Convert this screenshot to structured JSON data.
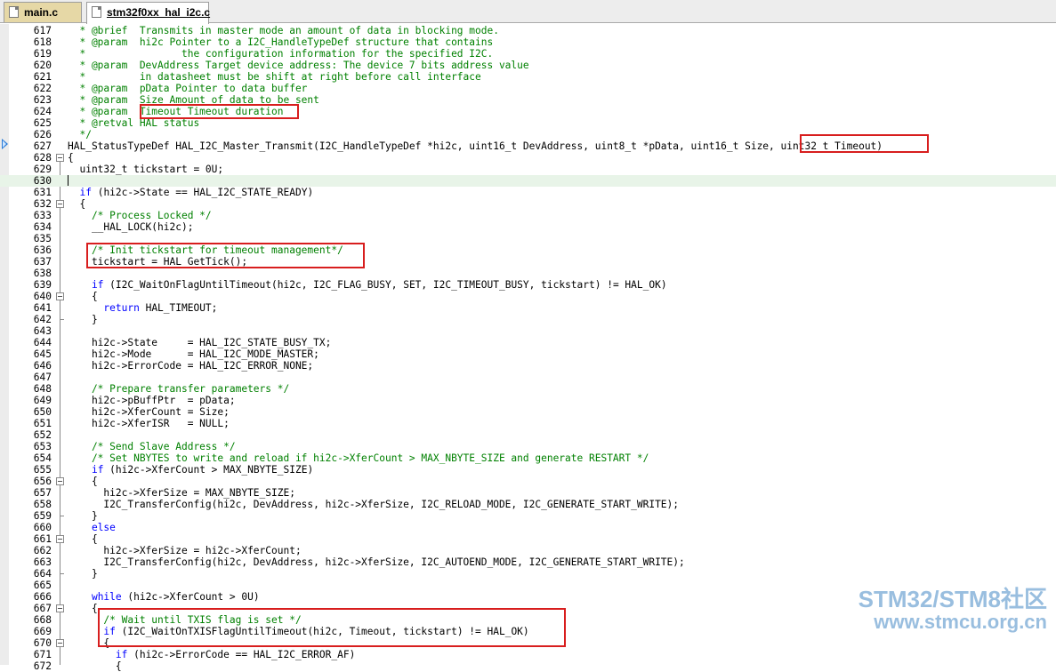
{
  "tabs": [
    {
      "label": "main.c",
      "active": false
    },
    {
      "label": "stm32f0xx_hal_i2c.c",
      "active": true
    }
  ],
  "editor": {
    "current_line": "630",
    "execution_line": "627",
    "lines": [
      {
        "num": "617",
        "fold": "",
        "segs": [
          {
            "t": "  * @brief  Transmits in master mode an amount of data in blocking mode.",
            "c": "c"
          }
        ]
      },
      {
        "num": "618",
        "fold": "",
        "segs": [
          {
            "t": "  * @param  hi2c Pointer to a I2C_HandleTypeDef structure that contains",
            "c": "c"
          }
        ]
      },
      {
        "num": "619",
        "fold": "",
        "segs": [
          {
            "t": "  *                the configuration information for the specified I2C.",
            "c": "c"
          }
        ]
      },
      {
        "num": "620",
        "fold": "",
        "segs": [
          {
            "t": "  * @param  DevAddress Target device address: The device 7 bits address value",
            "c": "c"
          }
        ]
      },
      {
        "num": "621",
        "fold": "",
        "segs": [
          {
            "t": "  *         in datasheet must be shift at right before call interface",
            "c": "c"
          }
        ]
      },
      {
        "num": "622",
        "fold": "",
        "segs": [
          {
            "t": "  * @param  pData Pointer to data buffer",
            "c": "c"
          }
        ]
      },
      {
        "num": "623",
        "fold": "",
        "segs": [
          {
            "t": "  * @param  Size Amount of data to be sent",
            "c": "c"
          }
        ]
      },
      {
        "num": "624",
        "fold": "",
        "segs": [
          {
            "t": "  * @param  Timeout Timeout duration",
            "c": "c"
          }
        ]
      },
      {
        "num": "625",
        "fold": "",
        "segs": [
          {
            "t": "  * @retval HAL status",
            "c": "c"
          }
        ]
      },
      {
        "num": "626",
        "fold": "",
        "segs": [
          {
            "t": "  */",
            "c": "c"
          }
        ]
      },
      {
        "num": "627",
        "fold": "",
        "segs": [
          {
            "t": "HAL_StatusTypeDef HAL_I2C_Master_Transmit(I2C_HandleTypeDef *hi2c, uint16_t DevAddress, uint8_t *pData, uint16_t Size, uint32_t Timeout)",
            "c": "n"
          }
        ]
      },
      {
        "num": "628",
        "fold": "open",
        "segs": [
          {
            "t": "{",
            "c": "n"
          }
        ]
      },
      {
        "num": "629",
        "fold": "",
        "segs": [
          {
            "t": "  uint32_t tickstart = 0U;",
            "c": "n"
          }
        ]
      },
      {
        "num": "630",
        "fold": "",
        "segs": [
          {
            "t": "",
            "c": "n"
          }
        ]
      },
      {
        "num": "631",
        "fold": "",
        "segs": [
          {
            "t": "  ",
            "c": "n"
          },
          {
            "t": "if",
            "c": "k"
          },
          {
            "t": " (hi2c->State == HAL_I2C_STATE_READY)",
            "c": "n"
          }
        ]
      },
      {
        "num": "632",
        "fold": "open",
        "segs": [
          {
            "t": "  {",
            "c": "n"
          }
        ]
      },
      {
        "num": "633",
        "fold": "",
        "segs": [
          {
            "t": "    /* Process Locked */",
            "c": "c"
          }
        ]
      },
      {
        "num": "634",
        "fold": "",
        "segs": [
          {
            "t": "    __HAL_LOCK(hi2c);",
            "c": "n"
          }
        ]
      },
      {
        "num": "635",
        "fold": "",
        "segs": [
          {
            "t": "",
            "c": "n"
          }
        ]
      },
      {
        "num": "636",
        "fold": "",
        "segs": [
          {
            "t": "    /* Init tickstart for timeout management*/",
            "c": "c"
          }
        ]
      },
      {
        "num": "637",
        "fold": "",
        "segs": [
          {
            "t": "    tickstart = HAL_GetTick();",
            "c": "n"
          }
        ]
      },
      {
        "num": "638",
        "fold": "",
        "segs": [
          {
            "t": "",
            "c": "n"
          }
        ]
      },
      {
        "num": "639",
        "fold": "",
        "segs": [
          {
            "t": "    ",
            "c": "n"
          },
          {
            "t": "if",
            "c": "k"
          },
          {
            "t": " (I2C_WaitOnFlagUntilTimeout(hi2c, I2C_FLAG_BUSY, SET, I2C_TIMEOUT_BUSY, tickstart) != HAL_OK)",
            "c": "n"
          }
        ]
      },
      {
        "num": "640",
        "fold": "open",
        "segs": [
          {
            "t": "    {",
            "c": "n"
          }
        ]
      },
      {
        "num": "641",
        "fold": "",
        "segs": [
          {
            "t": "      ",
            "c": "n"
          },
          {
            "t": "return",
            "c": "k"
          },
          {
            "t": " HAL_TIMEOUT;",
            "c": "n"
          }
        ]
      },
      {
        "num": "642",
        "fold": "",
        "segs": [
          {
            "t": "    }",
            "c": "n"
          }
        ]
      },
      {
        "num": "643",
        "fold": "",
        "segs": [
          {
            "t": "",
            "c": "n"
          }
        ]
      },
      {
        "num": "644",
        "fold": "",
        "segs": [
          {
            "t": "    hi2c->State     = HAL_I2C_STATE_BUSY_TX;",
            "c": "n"
          }
        ]
      },
      {
        "num": "645",
        "fold": "",
        "segs": [
          {
            "t": "    hi2c->Mode      = HAL_I2C_MODE_MASTER;",
            "c": "n"
          }
        ]
      },
      {
        "num": "646",
        "fold": "",
        "segs": [
          {
            "t": "    hi2c->ErrorCode = HAL_I2C_ERROR_NONE;",
            "c": "n"
          }
        ]
      },
      {
        "num": "647",
        "fold": "",
        "segs": [
          {
            "t": "",
            "c": "n"
          }
        ]
      },
      {
        "num": "648",
        "fold": "",
        "segs": [
          {
            "t": "    /* Prepare transfer parameters */",
            "c": "c"
          }
        ]
      },
      {
        "num": "649",
        "fold": "",
        "segs": [
          {
            "t": "    hi2c->pBuffPtr  = pData;",
            "c": "n"
          }
        ]
      },
      {
        "num": "650",
        "fold": "",
        "segs": [
          {
            "t": "    hi2c->XferCount = Size;",
            "c": "n"
          }
        ]
      },
      {
        "num": "651",
        "fold": "",
        "segs": [
          {
            "t": "    hi2c->XferISR   = NULL;",
            "c": "n"
          }
        ]
      },
      {
        "num": "652",
        "fold": "",
        "segs": [
          {
            "t": "",
            "c": "n"
          }
        ]
      },
      {
        "num": "653",
        "fold": "",
        "segs": [
          {
            "t": "    /* Send Slave Address */",
            "c": "c"
          }
        ]
      },
      {
        "num": "654",
        "fold": "",
        "segs": [
          {
            "t": "    /* Set NBYTES to write and reload if hi2c->XferCount > MAX_NBYTE_SIZE and generate RESTART */",
            "c": "c"
          }
        ]
      },
      {
        "num": "655",
        "fold": "",
        "segs": [
          {
            "t": "    ",
            "c": "n"
          },
          {
            "t": "if",
            "c": "k"
          },
          {
            "t": " (hi2c->XferCount > MAX_NBYTE_SIZE)",
            "c": "n"
          }
        ]
      },
      {
        "num": "656",
        "fold": "open",
        "segs": [
          {
            "t": "    {",
            "c": "n"
          }
        ]
      },
      {
        "num": "657",
        "fold": "",
        "segs": [
          {
            "t": "      hi2c->XferSize = MAX_NBYTE_SIZE;",
            "c": "n"
          }
        ]
      },
      {
        "num": "658",
        "fold": "",
        "segs": [
          {
            "t": "      I2C_TransferConfig(hi2c, DevAddress, hi2c->XferSize, I2C_RELOAD_MODE, I2C_GENERATE_START_WRITE);",
            "c": "n"
          }
        ]
      },
      {
        "num": "659",
        "fold": "",
        "segs": [
          {
            "t": "    }",
            "c": "n"
          }
        ]
      },
      {
        "num": "660",
        "fold": "",
        "segs": [
          {
            "t": "    ",
            "c": "n"
          },
          {
            "t": "else",
            "c": "k"
          }
        ]
      },
      {
        "num": "661",
        "fold": "open",
        "segs": [
          {
            "t": "    {",
            "c": "n"
          }
        ]
      },
      {
        "num": "662",
        "fold": "",
        "segs": [
          {
            "t": "      hi2c->XferSize = hi2c->XferCount;",
            "c": "n"
          }
        ]
      },
      {
        "num": "663",
        "fold": "",
        "segs": [
          {
            "t": "      I2C_TransferConfig(hi2c, DevAddress, hi2c->XferSize, I2C_AUTOEND_MODE, I2C_GENERATE_START_WRITE);",
            "c": "n"
          }
        ]
      },
      {
        "num": "664",
        "fold": "",
        "segs": [
          {
            "t": "    }",
            "c": "n"
          }
        ]
      },
      {
        "num": "665",
        "fold": "",
        "segs": [
          {
            "t": "",
            "c": "n"
          }
        ]
      },
      {
        "num": "666",
        "fold": "",
        "segs": [
          {
            "t": "    ",
            "c": "n"
          },
          {
            "t": "while",
            "c": "k"
          },
          {
            "t": " (hi2c->XferCount > 0U)",
            "c": "n"
          }
        ]
      },
      {
        "num": "667",
        "fold": "open",
        "segs": [
          {
            "t": "    {",
            "c": "n"
          }
        ]
      },
      {
        "num": "668",
        "fold": "",
        "segs": [
          {
            "t": "      /* Wait until TXIS flag is set */",
            "c": "c"
          }
        ]
      },
      {
        "num": "669",
        "fold": "",
        "segs": [
          {
            "t": "      ",
            "c": "n"
          },
          {
            "t": "if",
            "c": "k"
          },
          {
            "t": " (I2C_WaitOnTXISFlagUntilTimeout(hi2c, Timeout, tickstart) != HAL_OK)",
            "c": "n"
          }
        ]
      },
      {
        "num": "670",
        "fold": "open",
        "segs": [
          {
            "t": "      {",
            "c": "n"
          }
        ]
      },
      {
        "num": "671",
        "fold": "",
        "segs": [
          {
            "t": "        ",
            "c": "n"
          },
          {
            "t": "if",
            "c": "k"
          },
          {
            "t": " (hi2c->ErrorCode == HAL_I2C_ERROR_AF)",
            "c": "n"
          }
        ]
      },
      {
        "num": "672",
        "fold": "",
        "segs": [
          {
            "t": "        {",
            "c": "n"
          }
        ]
      }
    ]
  },
  "annotations": {
    "highlight_color": "#d81e1e"
  },
  "watermark": {
    "line1": "STM32/STM8社区",
    "line2": "www.stmcu.org.cn"
  },
  "colors": {
    "comment": "#008000",
    "keyword": "#0000ff",
    "current_line_bg": "#e8f4e8",
    "tab_inactive_bg": "#e6d8a6",
    "exec_arrow": "#2a7bd6"
  }
}
